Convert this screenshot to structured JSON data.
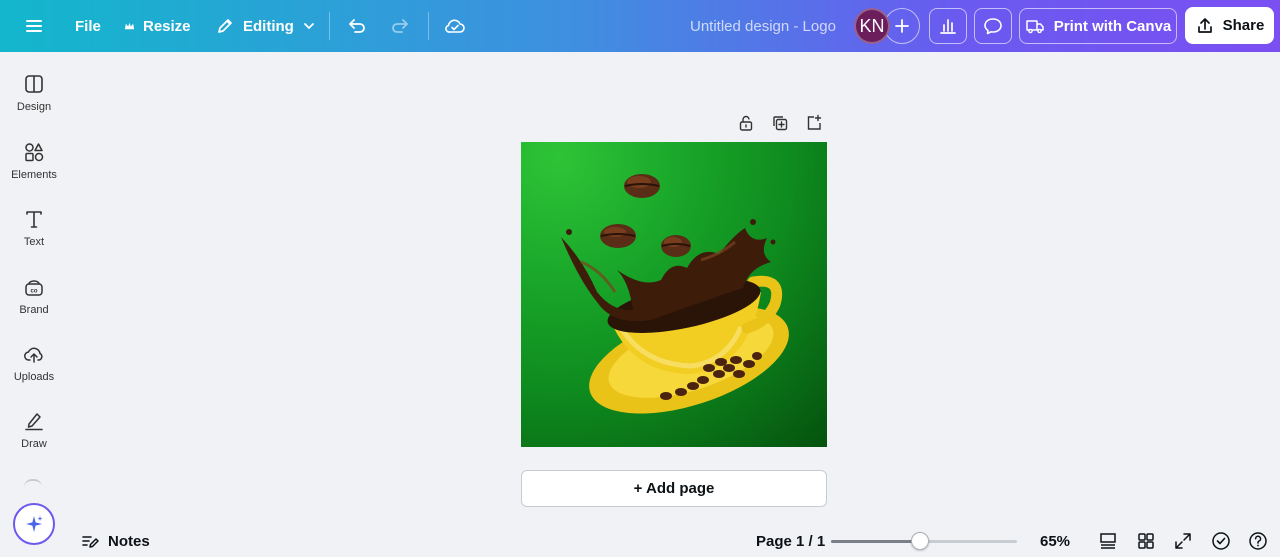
{
  "topbar": {
    "file_label": "File",
    "resize_label": "Resize",
    "editing_label": "Editing",
    "design_title": "Untitled design - Logo",
    "avatar_initials": "KN",
    "print_label": "Print with Canva",
    "share_label": "Share"
  },
  "sidebar": {
    "items": [
      {
        "label": "Design",
        "icon": "design-icon"
      },
      {
        "label": "Elements",
        "icon": "elements-icon"
      },
      {
        "label": "Text",
        "icon": "text-icon"
      },
      {
        "label": "Brand",
        "icon": "brand-icon"
      },
      {
        "label": "Uploads",
        "icon": "uploads-icon"
      },
      {
        "label": "Draw",
        "icon": "draw-icon"
      }
    ]
  },
  "canvas": {
    "add_page_label": "+ Add page",
    "background_colors": [
      "#2ec437",
      "#05520e"
    ]
  },
  "bottombar": {
    "notes_label": "Notes",
    "page_indicator": "Page 1 / 1",
    "zoom_value": "65%",
    "zoom_fraction": 0.48
  }
}
